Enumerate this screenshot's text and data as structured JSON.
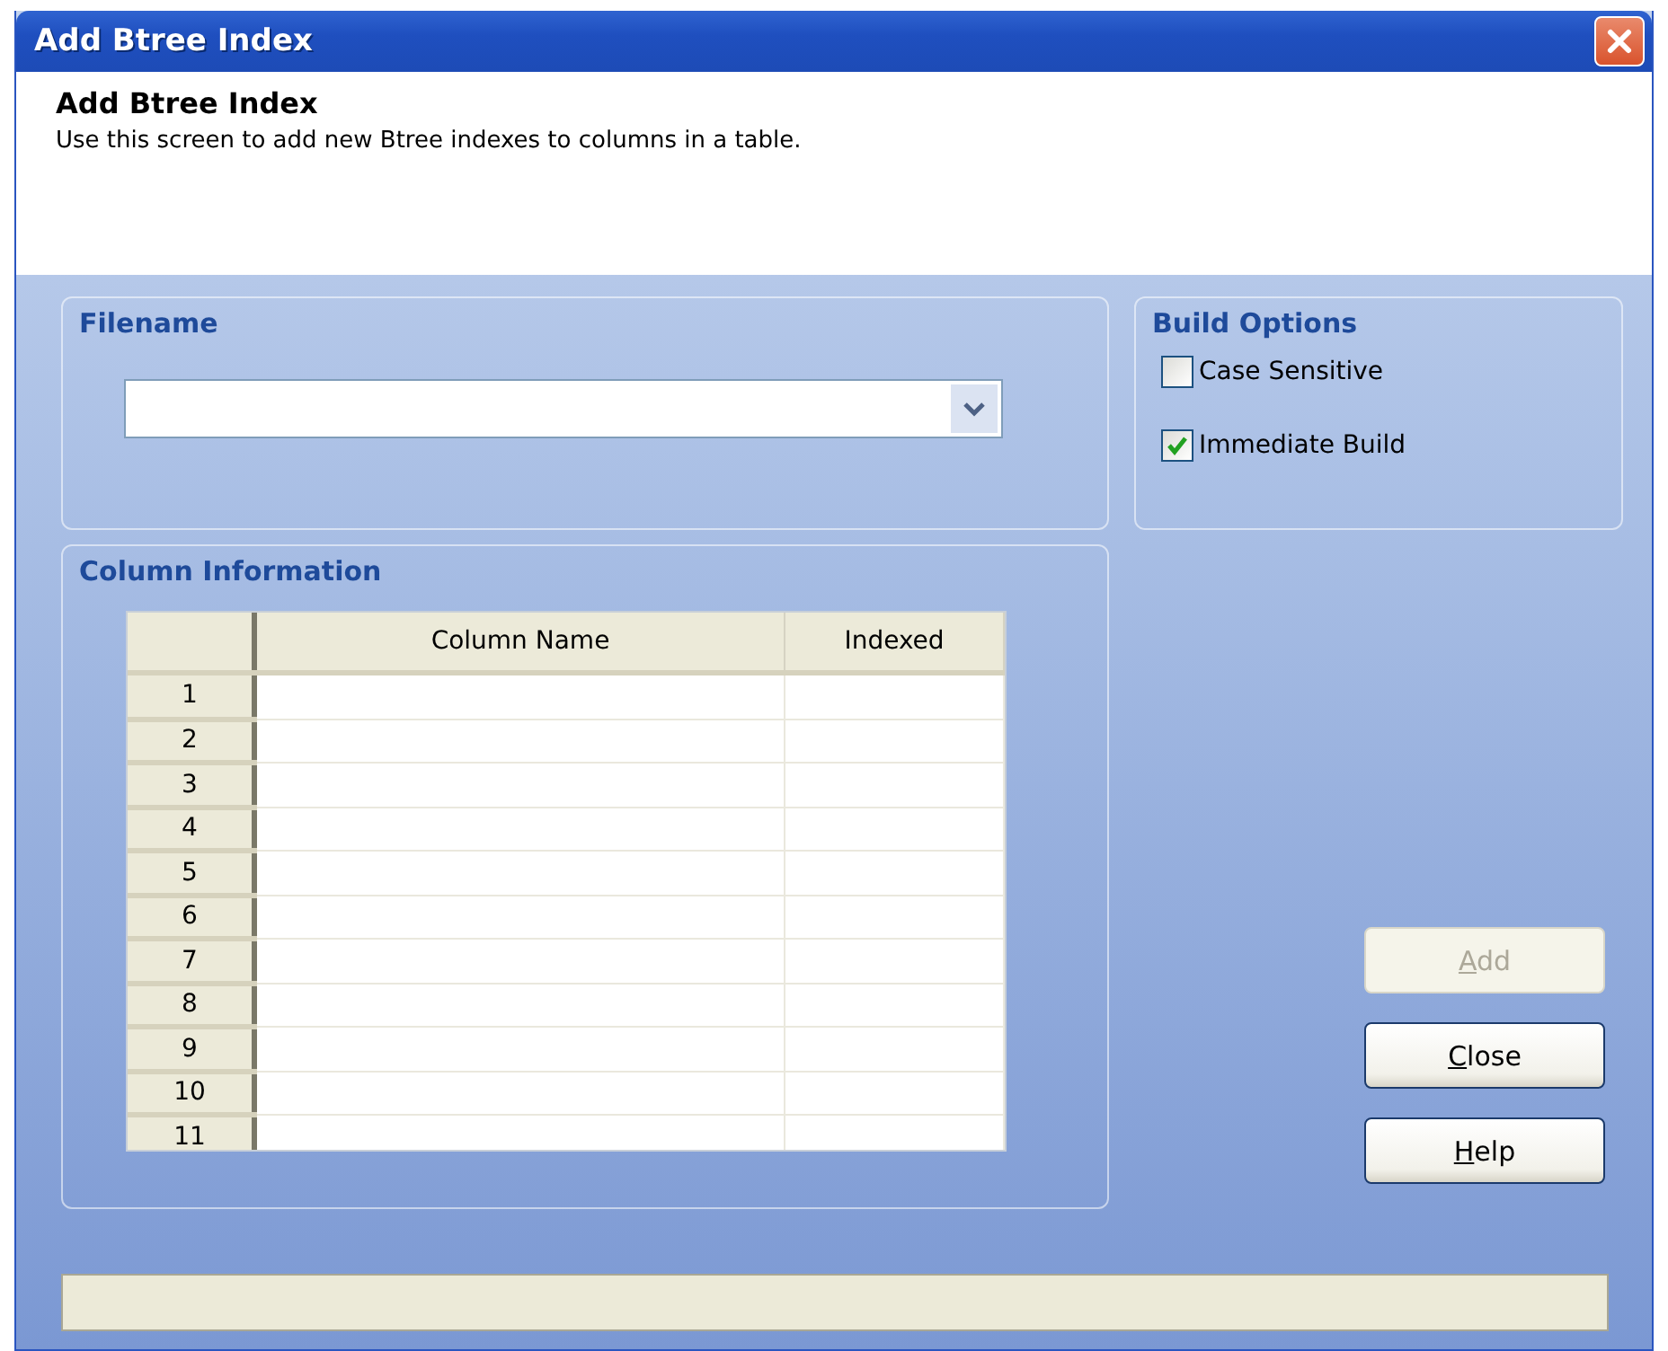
{
  "window": {
    "title": "Add Btree Index"
  },
  "header": {
    "title": "Add Btree Index",
    "description": "Use this screen to add new Btree indexes to columns in a table."
  },
  "filename": {
    "label": "Filename"
  },
  "build_options": {
    "label": "Build Options",
    "options": [
      {
        "label": "Case Sensitive",
        "checked": false
      },
      {
        "label": "Immediate Build",
        "checked": true
      }
    ]
  },
  "column_information": {
    "label": "Column Information",
    "table": {
      "columns": [
        "Column Name",
        "Indexed"
      ],
      "rows": [
        {
          "number": "1"
        },
        {
          "number": "2"
        },
        {
          "number": "3"
        },
        {
          "number": "4"
        },
        {
          "number": "5"
        },
        {
          "number": "6"
        },
        {
          "number": "7"
        },
        {
          "number": "8"
        },
        {
          "number": "9"
        },
        {
          "number": "10"
        },
        {
          "number": "11"
        }
      ]
    }
  },
  "buttons": [
    {
      "label": "Add",
      "disabled": true,
      "mnemonic": true
    },
    {
      "label": "Close",
      "disabled": false,
      "mnemonic": true
    },
    {
      "label": "Help",
      "disabled": false,
      "mnemonic": true
    }
  ]
}
